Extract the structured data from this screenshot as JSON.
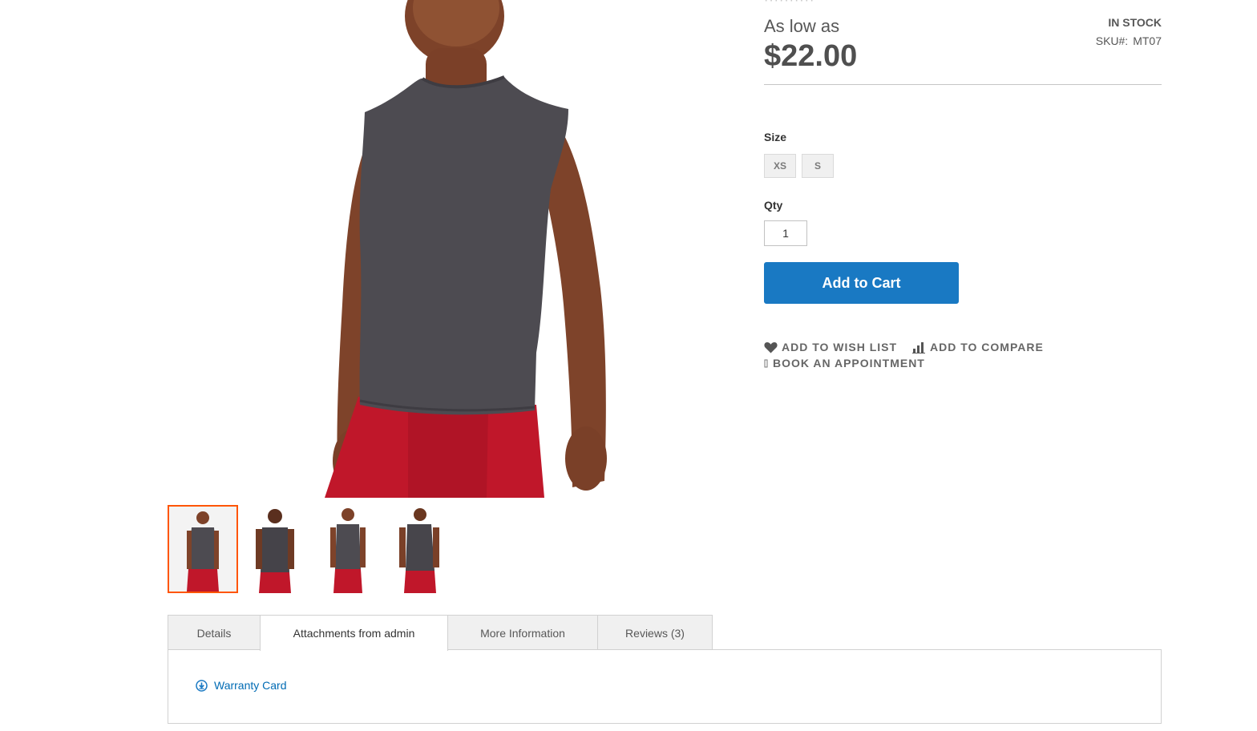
{
  "product": {
    "rating_dots": "··········",
    "price_label": "As low as",
    "price": "$22.00",
    "stock": "In stock",
    "sku_label": "SKU#:",
    "sku": "MT07"
  },
  "options": {
    "size_label": "Size",
    "sizes": [
      "XS",
      "S"
    ],
    "qty_label": "Qty",
    "qty_value": "1"
  },
  "actions": {
    "add_to_cart": "Add to Cart",
    "wishlist": "Add to Wish List",
    "compare": "Add to Compare",
    "appointment": "Book an Appointment"
  },
  "tabs": [
    {
      "label": "Details"
    },
    {
      "label": "Attachments from admin"
    },
    {
      "label": "More Information"
    },
    {
      "label": "Reviews (3)"
    }
  ],
  "attachments": [
    {
      "label": "Warranty Card"
    }
  ],
  "colors": {
    "accent": "#1979c3",
    "thumb_active": "#ff5501",
    "shirt": "#4d4b51",
    "shorts": "#c0172a",
    "skin": "#8a4a2e",
    "link": "#006bb4"
  }
}
